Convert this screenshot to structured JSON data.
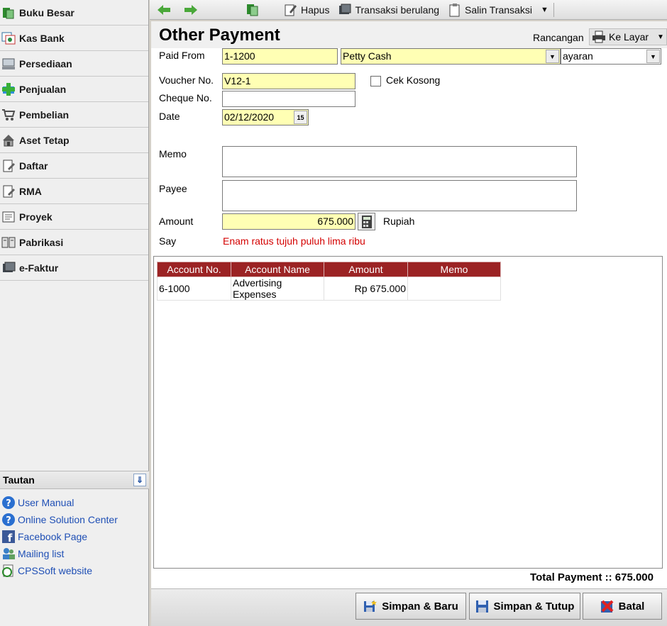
{
  "sidebar": {
    "items": [
      {
        "label": "Buku Besar",
        "icon": "ledger-icon"
      },
      {
        "label": "Kas Bank",
        "icon": "bank-icon"
      },
      {
        "label": "Persediaan",
        "icon": "inventory-icon"
      },
      {
        "label": "Penjualan",
        "icon": "sales-icon"
      },
      {
        "label": "Pembelian",
        "icon": "cart-icon"
      },
      {
        "label": "Aset Tetap",
        "icon": "house-icon"
      },
      {
        "label": "Daftar",
        "icon": "list-icon"
      },
      {
        "label": "RMA",
        "icon": "rma-icon"
      },
      {
        "label": "Proyek",
        "icon": "project-icon"
      },
      {
        "label": "Pabrikasi",
        "icon": "factory-icon"
      },
      {
        "label": "e-Faktur",
        "icon": "efaktur-icon"
      }
    ],
    "tautan_title": "Tautan",
    "links": [
      {
        "label": "User Manual",
        "icon": "help-icon"
      },
      {
        "label": "Online Solution Center",
        "icon": "help-icon"
      },
      {
        "label": "Facebook Page",
        "icon": "facebook-icon"
      },
      {
        "label": "Mailing list",
        "icon": "users-icon"
      },
      {
        "label": "CPSSoft website",
        "icon": "web-icon"
      }
    ]
  },
  "toolbar": {
    "delete_label": "Hapus",
    "recurring_label": "Transaksi berulang",
    "copy_label": "Salin Transaksi"
  },
  "form": {
    "title": "Other Payment",
    "rancangan_label": "Rancangan",
    "print_target": "Ke Layar",
    "paid_from_label": "Paid From",
    "paid_from_code": "1-1200",
    "paid_from_name": "Petty Cash",
    "payment_method": "ayaran",
    "voucher_label": "Voucher No.",
    "voucher_value": "V12-1",
    "cek_kosong_label": "Cek Kosong",
    "cheque_label": "Cheque No.",
    "cheque_value": "",
    "date_label": "Date",
    "date_value": "02/12/2020",
    "memo_label": "Memo",
    "memo_value": "",
    "payee_label": "Payee",
    "payee_value": "",
    "amount_label": "Amount",
    "amount_value": "675.000",
    "currency": "Rupiah",
    "say_label": "Say",
    "say_value": "Enam ratus tujuh puluh lima ribu"
  },
  "grid": {
    "headers": [
      "Account No.",
      "Account Name",
      "Amount",
      "Memo"
    ],
    "rows": [
      [
        "6-1000",
        "Advertising Expenses",
        "Rp 675.000",
        ""
      ]
    ]
  },
  "total_payment": "Total Payment :: 675.000",
  "actions": {
    "save_new": "Simpan & Baru",
    "save_close": "Simpan & Tutup",
    "cancel": "Batal"
  },
  "colors": {
    "grid_header": "#9b2324",
    "field_yellow": "#ffffb4",
    "say_red": "#d40000",
    "link_blue": "#1f4fb5"
  }
}
